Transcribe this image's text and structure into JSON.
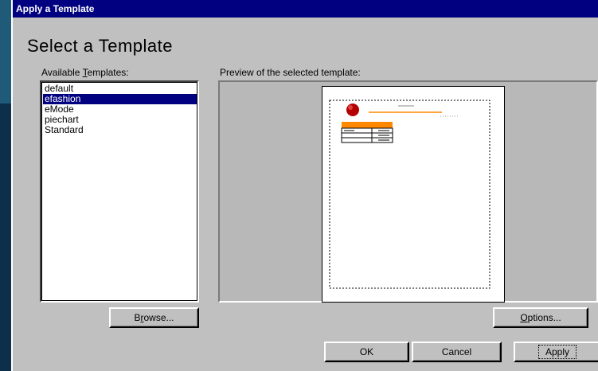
{
  "window": {
    "title": "Apply a Template"
  },
  "heading": "Select a Template",
  "templates": {
    "label_prefix": "Available ",
    "label_accel": "T",
    "label_suffix": "emplates:",
    "items": [
      "default",
      "efashion",
      "eMode",
      "piechart",
      "Standard"
    ],
    "selected": "efashion"
  },
  "preview": {
    "label": "Preview of the selected template:"
  },
  "buttons": {
    "browse_accel": "r",
    "browse_pre": "B",
    "browse_post": "owse...",
    "options_accel": "O",
    "options_post": "ptions...",
    "ok": "OK",
    "cancel": "Cancel",
    "apply": "Apply"
  },
  "colors": {
    "titlebar": "#000080",
    "selection": "#000080",
    "dialog": "#c0c0c0",
    "preview_band": "#ff8800",
    "preview_logo": "#b40000"
  }
}
